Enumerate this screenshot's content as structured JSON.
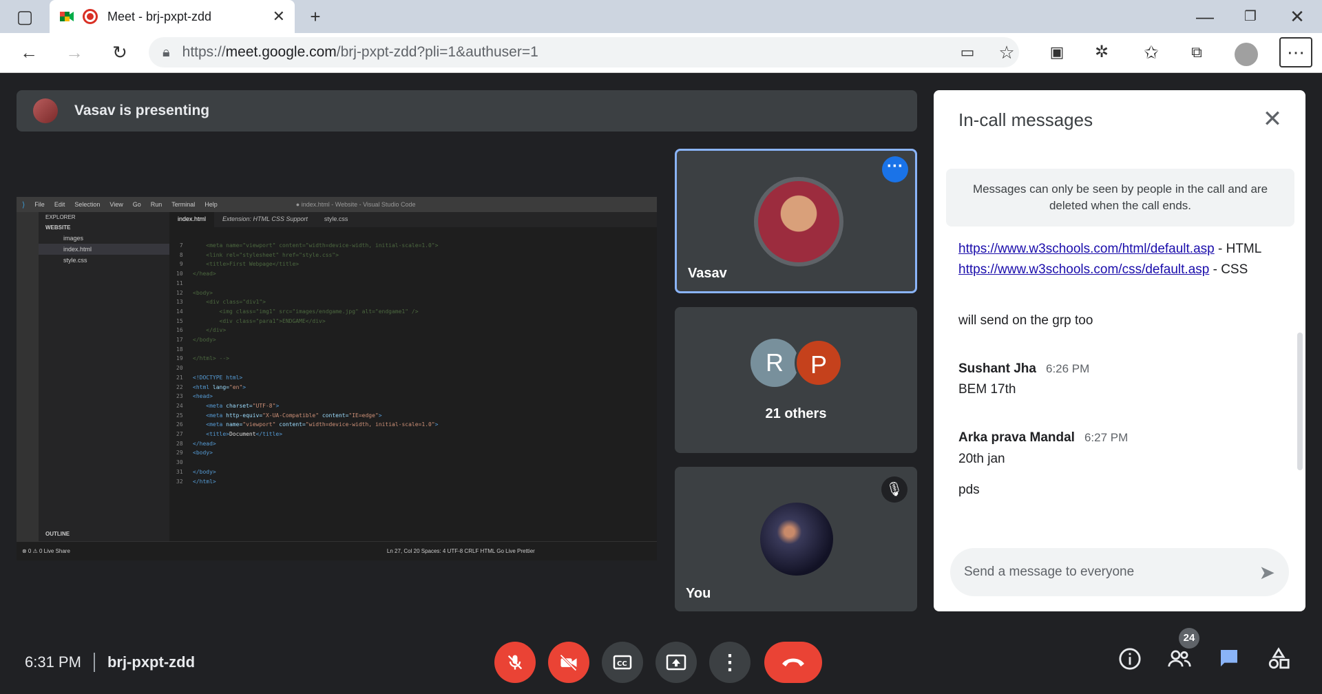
{
  "browser": {
    "tab_title": "Meet - brj-pxpt-zdd",
    "url_prefix": "https://",
    "url_host": "meet.google.com",
    "url_path": "/brj-pxpt-zdd?pli=1&authuser=1",
    "new_tab": "+"
  },
  "presenter_banner": "Vasav is presenting",
  "shared_screen": {
    "window_title": "● index.html - Website - Visual Studio Code",
    "menu": [
      "File",
      "Edit",
      "Selection",
      "View",
      "Go",
      "Run",
      "Terminal",
      "Help"
    ],
    "tabs": [
      "index.html",
      "Extension: HTML CSS Support",
      "style.css"
    ],
    "explorer_title": "EXPLORER",
    "folder": "WEBSITE",
    "files": [
      "images",
      "index.html",
      "style.css"
    ],
    "outline": "OUTLINE",
    "status_left": "⊗ 0 ⚠ 0   Live Share",
    "status_right": "Ln 27, Col 20   Spaces: 4   UTF-8   CRLF   HTML   Go Live   Prettier"
  },
  "tiles": {
    "vasav_name": "Vasav",
    "others_label": "21 others",
    "others_letters": [
      "R",
      "P"
    ],
    "you_name": "You"
  },
  "chat": {
    "title": "In-call messages",
    "notice": "Messages can only be seen by people in the call and are deleted when the call ends.",
    "link1": "https://www.w3schools.com/html/default.asp",
    "link1_suffix": " - HTML",
    "link2": "https://www.w3schools.com/css/default.asp",
    "link2_suffix": " - CSS",
    "msg_grp": "will send on the grp too",
    "sender1": "Sushant Jha",
    "time1": "6:26 PM",
    "msg1": "BEM 17th",
    "sender2": "Arka prava Mandal",
    "time2": "6:27 PM",
    "msg2a": "20th jan",
    "msg2b": "pds",
    "input_placeholder": "Send a message to everyone"
  },
  "bottom": {
    "time": "6:31 PM",
    "meeting_code": "brj-pxpt-zdd",
    "participants_count": "24"
  },
  "colors": {
    "accent": "#1a73e8",
    "danger": "#ea4335",
    "bg": "#202124",
    "tile": "#3c4043"
  }
}
